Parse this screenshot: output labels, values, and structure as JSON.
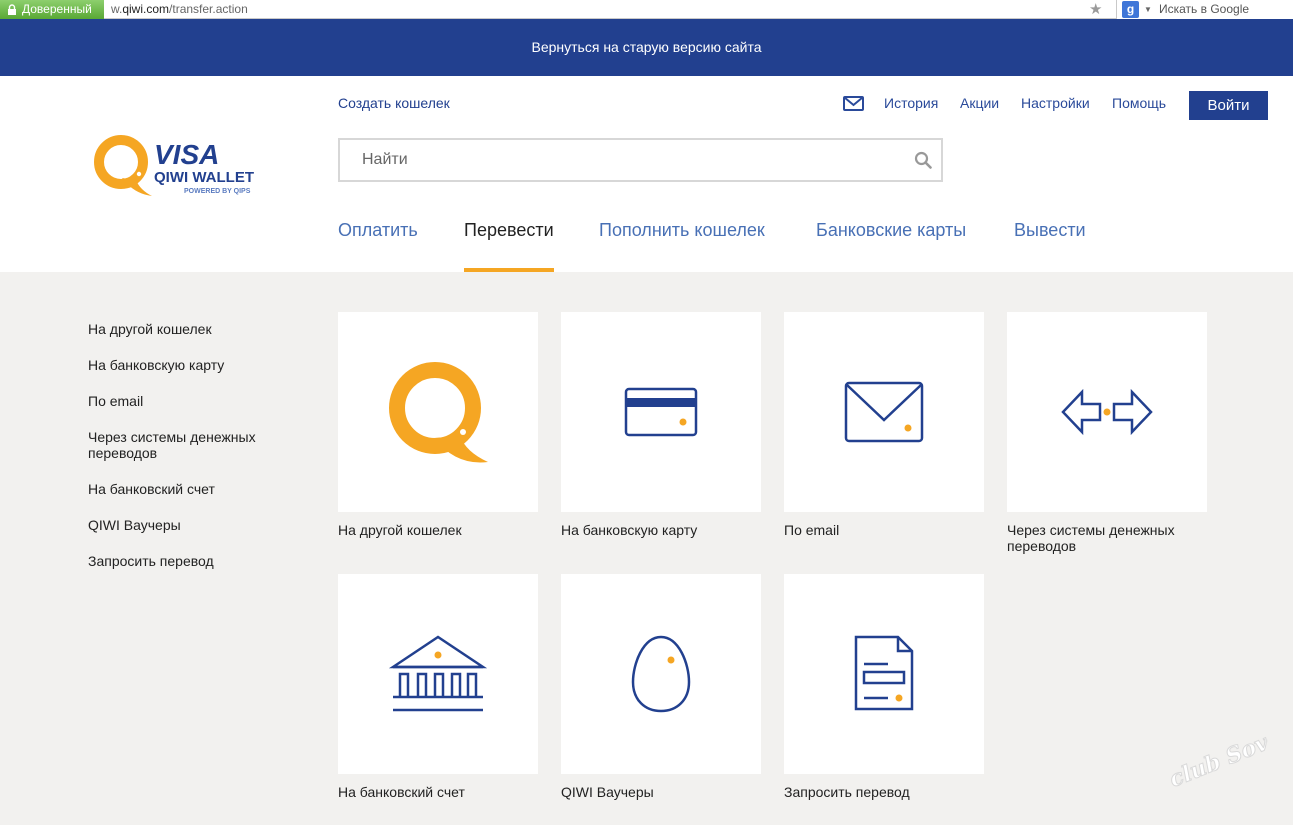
{
  "browser": {
    "trusted_label": "Доверенный",
    "url_prefix": "w.",
    "url_domain": "qiwi.com",
    "url_path": "/transfer.action",
    "search_placeholder": "Искать в Google"
  },
  "banner": {
    "text": "Вернуться на старую версию сайта"
  },
  "header": {
    "create_wallet": "Создать кошелек",
    "topnav": [
      "История",
      "Акции",
      "Настройки",
      "Помощь"
    ],
    "login_label": "Войти",
    "search_placeholder": "Найти",
    "logo": {
      "brand": "VISA",
      "product": "QIWI WALLET",
      "powered": "POWERED BY QIPS"
    }
  },
  "mainnav": {
    "tabs": [
      {
        "label": "Оплатить"
      },
      {
        "label": "Перевести",
        "active": true
      },
      {
        "label": "Пополнить кошелек"
      },
      {
        "label": "Банковские карты"
      },
      {
        "label": "Вывести"
      }
    ]
  },
  "sidebar": {
    "items": [
      "На другой кошелек",
      "На банковскую карту",
      "По email",
      "Через системы денежных переводов",
      "На банковский счет",
      "QIWI Ваучеры",
      "Запросить перевод"
    ]
  },
  "tiles": [
    {
      "label": "На другой кошелек",
      "icon": "qiwi-logo-icon"
    },
    {
      "label": "На банковскую карту",
      "icon": "bank-card-icon"
    },
    {
      "label": "По email",
      "icon": "envelope-icon"
    },
    {
      "label": "Через системы денежных переводов",
      "icon": "transfer-arrows-icon"
    },
    {
      "label": "На банковский счет",
      "icon": "bank-building-icon"
    },
    {
      "label": "QIWI Ваучеры",
      "icon": "egg-voucher-icon"
    },
    {
      "label": "Запросить перевод",
      "icon": "document-icon"
    }
  ],
  "watermark": {
    "text": "club Sovet"
  },
  "colors": {
    "brand_blue": "#22408f",
    "accent_orange": "#f5a623",
    "link_blue": "#4870b5",
    "background": "#f2f1ef"
  }
}
